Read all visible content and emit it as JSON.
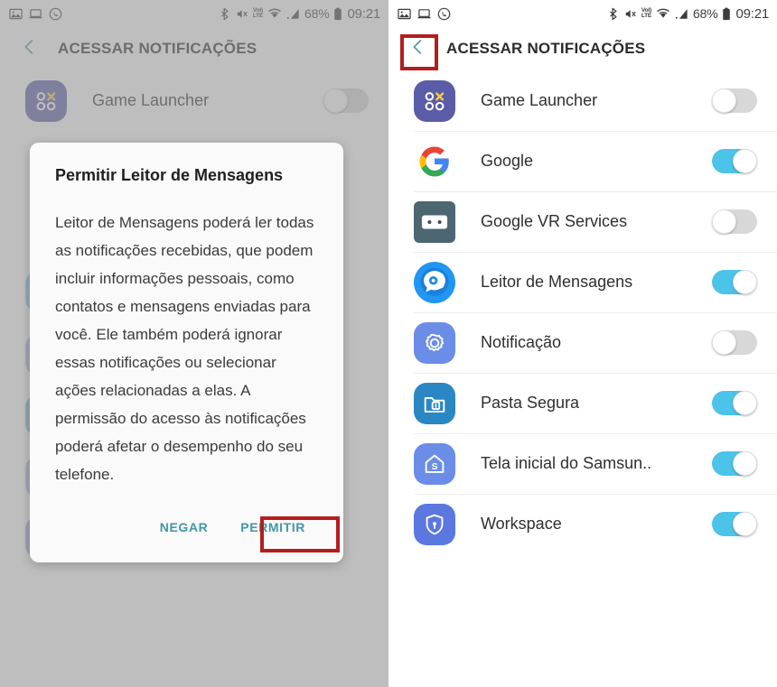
{
  "status_bar": {
    "left_icons": [
      "image-icon",
      "laptop-icon",
      "whatsapp-icon"
    ],
    "right_icons": [
      "bluetooth-icon",
      "mute-icon",
      "volte-icon",
      "wifi-icon",
      "signal-icon"
    ],
    "volte_top": "VoI)",
    "volte_bottom": "LTE",
    "battery_percent": "68%",
    "battery_icon": "battery-icon",
    "clock": "09:21"
  },
  "app_bar": {
    "title": "ACESSAR NOTIFICAÇÕES",
    "back_icon": "chevron-left-icon"
  },
  "left_panel": {
    "visible_row": {
      "label": "Game Launcher",
      "icon": "game-launcher-icon",
      "toggle": "off"
    },
    "dialog": {
      "title": "Permitir Leitor de Mensagens",
      "body": "Leitor de Mensagens poderá ler todas as notificações recebidas, que podem incluir informações pessoais, como contatos e mensagens enviadas para você. Ele também poderá ignorar essas notificações ou selecionar ações relacionadas a elas. A permissão do acesso às notificações poderá afetar o desempenho do seu telefone.",
      "deny_label": "NEGAR",
      "allow_label": "PERMITIR"
    }
  },
  "right_panel": {
    "rows": [
      {
        "label": "Game Launcher",
        "icon": "game-launcher-icon",
        "toggle": "off"
      },
      {
        "label": "Google",
        "icon": "google-icon",
        "toggle": "on"
      },
      {
        "label": "Google VR Services",
        "icon": "google-vr-icon",
        "toggle": "off"
      },
      {
        "label": "Leitor de Mensagens",
        "icon": "leitor-mensagens-icon",
        "toggle": "on"
      },
      {
        "label": "Notificação",
        "icon": "notification-gear-icon",
        "toggle": "off"
      },
      {
        "label": "Pasta Segura",
        "icon": "secure-folder-icon",
        "toggle": "on"
      },
      {
        "label": "Tela inicial do Samsun..",
        "icon": "samsung-home-icon",
        "toggle": "on"
      },
      {
        "label": "Workspace",
        "icon": "workspace-shield-icon",
        "toggle": "on"
      }
    ]
  },
  "colors": {
    "toggle_on": "#4cc3e8",
    "toggle_off": "#d8d8d8",
    "dialog_action": "#3f97ab",
    "annotation": "#b51d1d",
    "back_chevron": "#5a97a8"
  },
  "annotations": [
    {
      "name": "permitir-highlight",
      "target": "allow_label"
    },
    {
      "name": "back-button-highlight",
      "target": "back_icon"
    }
  ]
}
